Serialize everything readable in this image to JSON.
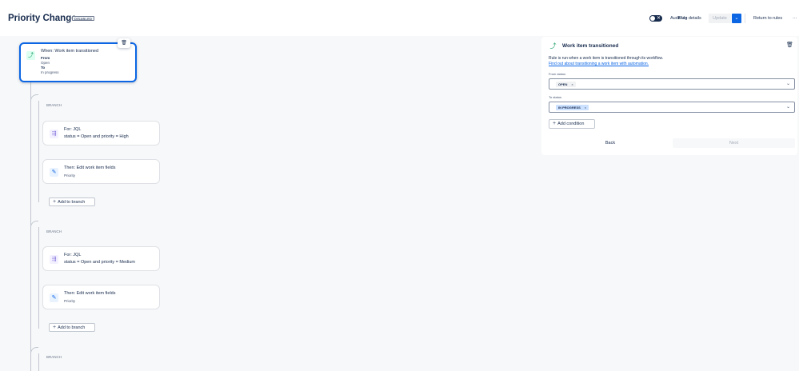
{
  "header": {
    "title": "Priority Change",
    "status_badge": "DISABLED",
    "toggle_mark": "✕",
    "audit_log": "Audit log",
    "rule_details": "Rule details",
    "update": "Update",
    "update_caret": "⌄",
    "return_to_rules": "Return to rules",
    "more": "···"
  },
  "trigger": {
    "icon": "transition-icon",
    "title": "When: Work item transitioned",
    "from_label": "From",
    "from_value": "Open",
    "to_label": "To",
    "to_value": "In progress",
    "delete_icon": "🗑"
  },
  "branches": [
    {
      "label": "BRANCH",
      "condition_title": "For: JQL",
      "condition_query": "status = Open and priority = High",
      "action_title": "Then: Edit work item fields",
      "action_field": "Priority",
      "add_label": "Add to branch"
    },
    {
      "label": "BRANCH",
      "condition_title": "For: JQL",
      "condition_query": "status = Open and priority = Medium",
      "action_title": "Then: Edit work item fields",
      "action_field": "Priority",
      "add_label": "Add to branch"
    },
    {
      "label": "BRANCH"
    }
  ],
  "panel": {
    "title": "Work item transitioned",
    "description": "Rule is run when a work item is transitioned through its workflow.",
    "link": "Find out about transitioning a work item with automation.",
    "from_status_label": "From status",
    "from_status_value": "OPEN",
    "to_status_label": "To status",
    "to_status_value": "IN PROGRESS",
    "chip_remove": "×",
    "add_condition": "Add condition",
    "back": "Back",
    "next": "Next",
    "delete_icon": "🗑"
  },
  "glyphs": {
    "transition": "⤴",
    "jql": "⇶",
    "edit": "✎",
    "plus": "+",
    "caret": "⌄"
  },
  "colors": {
    "accent": "#0c66e4",
    "transition_green": "#22a06b",
    "branch_purple": "#8270db"
  }
}
